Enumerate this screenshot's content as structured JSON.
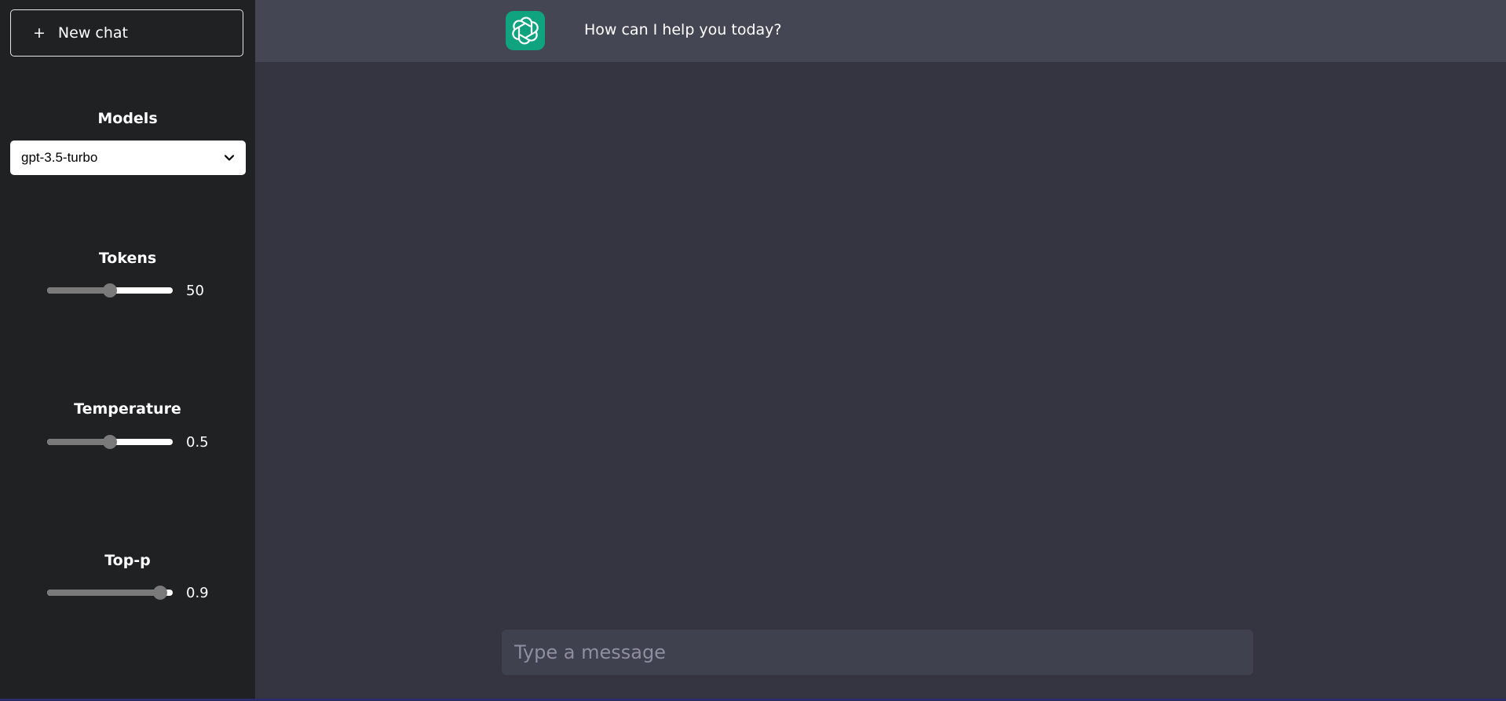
{
  "sidebar": {
    "new_chat": {
      "icon": "+",
      "label": "New chat"
    },
    "models": {
      "label": "Models",
      "selected": "gpt-3.5-turbo"
    },
    "tokens": {
      "label": "Tokens",
      "value": "50",
      "fraction": 0.5
    },
    "temperature": {
      "label": "Temperature",
      "value": "0.5",
      "fraction": 0.5
    },
    "top_p": {
      "label": "Top-p",
      "value": "0.9",
      "fraction": 0.9
    }
  },
  "header": {
    "logo_icon": "openai-logo-icon",
    "greeting": "How can I help you today?"
  },
  "composer": {
    "placeholder": "Type a message"
  },
  "colors": {
    "sidebar_bg": "#202123",
    "main_bg": "#343541",
    "header_bg": "#444654",
    "logo_bg": "#10a37f",
    "input_bg": "#40414f"
  }
}
